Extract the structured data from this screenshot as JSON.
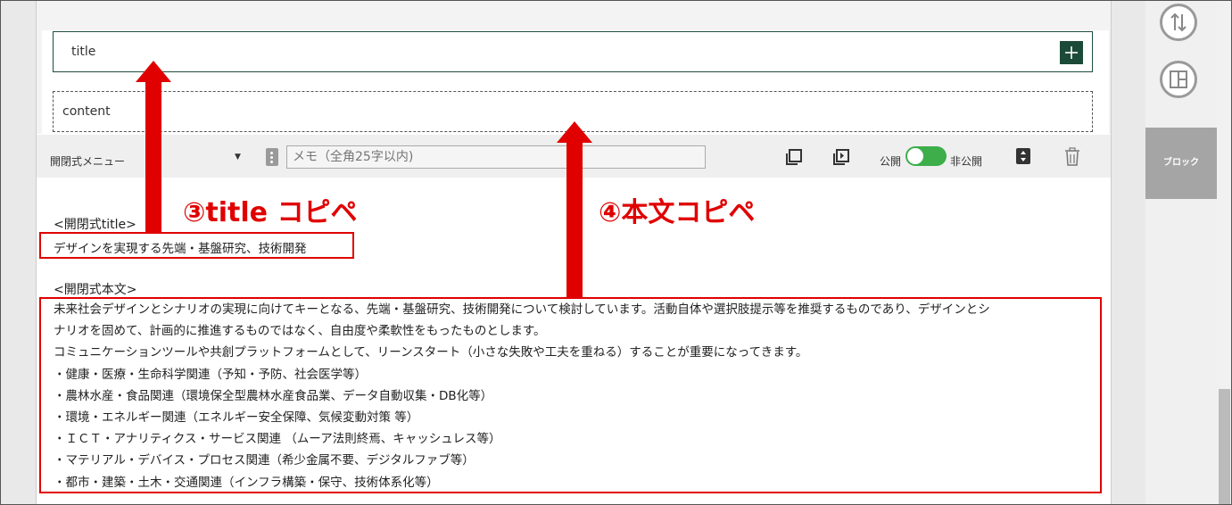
{
  "block": {
    "title_placeholder": "title",
    "content_placeholder": "content"
  },
  "toolbar": {
    "menu_type": "開閉式メニュー",
    "memo_placeholder": "メモ（全角25字以内)",
    "public_label": "公開",
    "private_label": "非公開",
    "toggle_state": "公開"
  },
  "document": {
    "title_heading": "<開閉式title>",
    "title_text": "デザインを実現する先端・基盤研究、技術開発",
    "body_heading": "<開閉式本文>",
    "body_lines": [
      "未来社会デザインとシナリオの実現に向けてキーとなる、先端・基盤研究、技術開発について検討しています。活動自体や選択肢提示等を推奨するものであり、デザインとシ",
      "ナリオを固めて、計画的に推進するものではなく、自由度や柔軟性をもったものとします。",
      "コミュニケーションツールや共創プラットフォームとして、リーンスタート（小さな失敗や工夫を重ねる）することが重要になってきます。",
      "・健康・医療・生命科学関連（予知・予防、社会医学等）",
      "・農林水産・食品関連（環境保全型農林水産食品業、データ自動収集・DB化等）",
      "・環境・エネルギー関連（エネルギー安全保障、気候変動対策 等）",
      "・ＩＣＴ・アナリティクス・サービス関連 （ムーア法則終焉、キャッシュレス等）",
      "・マテリアル・デバイス・プロセス関連（希少金属不要、デジタルファブ等）",
      "・都市・建築・土木・交通関連（インフラ構築・保守、技術体系化等）"
    ]
  },
  "annotations": {
    "title_copy": "③title コピペ",
    "body_copy": "④本文コピペ"
  },
  "sidebar": {
    "block_tab": "ブロック",
    "icons": [
      "sort-icon",
      "layout-icon"
    ]
  },
  "colors": {
    "accent_green": "#1c4a38",
    "annotation_red": "#e00000",
    "toggle_green": "#3dae4a"
  }
}
